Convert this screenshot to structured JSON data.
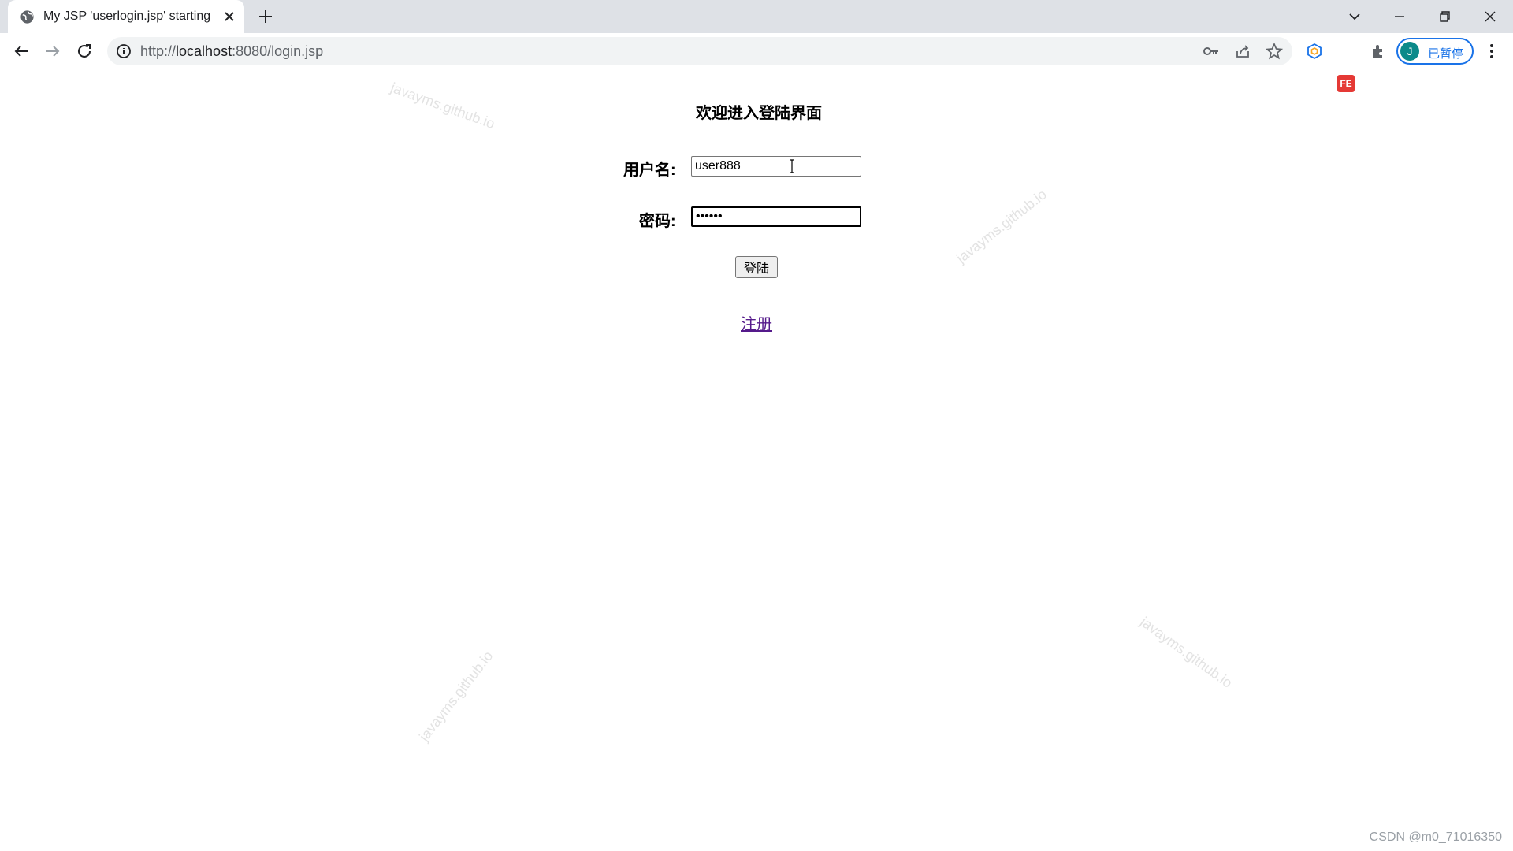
{
  "browser": {
    "tab_title": "My JSP 'userlogin.jsp' starting",
    "url_scheme": "http://",
    "url_host": "localhost",
    "url_path": ":8080/login.jsp",
    "profile_initial": "J",
    "profile_status": "已暂停",
    "fe_extension": "FE"
  },
  "form": {
    "heading": "欢迎进入登陆界面",
    "username_label": "用户名:",
    "username_value": "user888",
    "password_label": "密码:",
    "password_value": "••••••",
    "login_button": "登陆",
    "register_link": "注册"
  },
  "watermark_text": "javayms.github.io",
  "credit": "CSDN @m0_71016350",
  "colors": {
    "tabstrip": "#dee1e6",
    "omnibox": "#f1f3f4",
    "accent": "#1a73e8",
    "visited_link": "#551a8b"
  }
}
